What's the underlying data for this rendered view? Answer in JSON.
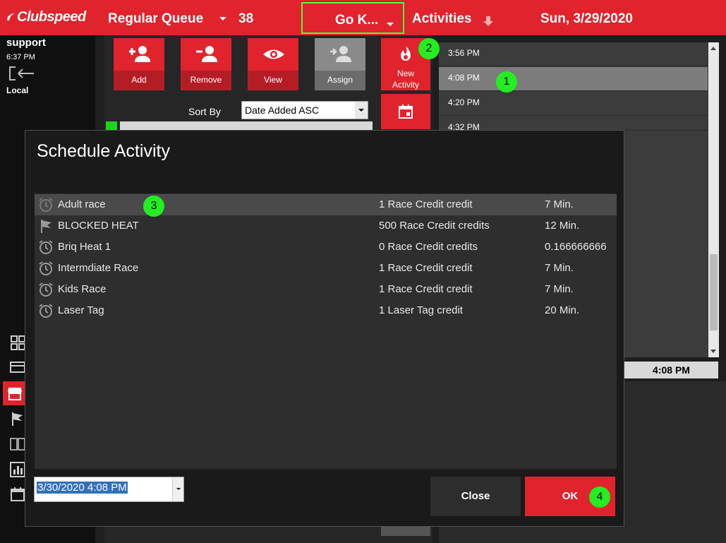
{
  "topbar": {
    "logo": "Clubspeed",
    "queue_label": "Regular Queue",
    "queue_count": "38",
    "track": "Go K...",
    "activities_label": "Activities",
    "date": "Sun, 3/29/2020"
  },
  "sidebar": {
    "user": "support",
    "time": "6:37 PM",
    "location": "Local"
  },
  "actions": {
    "add": "Add",
    "remove": "Remove",
    "view": "View",
    "assign": "Assign",
    "new_activity_line1": "New",
    "new_activity_line2": "Activity"
  },
  "sort": {
    "label": "Sort By",
    "value": "Date Added ASC"
  },
  "times": [
    "3:56 PM",
    "4:08 PM",
    "4:20 PM",
    "4:32 PM"
  ],
  "selected_time": "4:08 PM",
  "modal": {
    "title": "Schedule Activity",
    "activities": [
      {
        "name": "Adult race",
        "credits": "1 Race Credit credit",
        "duration": "7 Min.",
        "icon": "alarm-clock-icon"
      },
      {
        "name": "BLOCKED HEAT",
        "credits": "500 Race Credit credits",
        "duration": "12 Min.",
        "icon": "flag-icon"
      },
      {
        "name": "Briq Heat 1",
        "credits": "0 Race Credit credits",
        "duration": "0.166666666",
        "icon": "alarm-clock-icon"
      },
      {
        "name": "Intermdiate Race",
        "credits": "1 Race Credit credit",
        "duration": "7 Min.",
        "icon": "alarm-clock-icon"
      },
      {
        "name": "Kids Race",
        "credits": "1 Race Credit credit",
        "duration": "7 Min.",
        "icon": "alarm-clock-icon"
      },
      {
        "name": "Laser Tag",
        "credits": "1 Laser Tag credit",
        "duration": "20 Min.",
        "icon": "alarm-clock-icon"
      }
    ],
    "datetime": "3/30/2020 4:08 PM",
    "close_label": "Close",
    "ok_label": "OK"
  },
  "markers": [
    "1",
    "2",
    "3",
    "4"
  ],
  "colors": {
    "brand_red": "#e0232d",
    "highlight_green": "#22ee22"
  }
}
